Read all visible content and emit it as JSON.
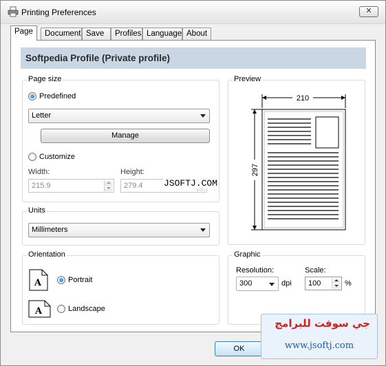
{
  "window": {
    "title": "Printing Preferences",
    "close_glyph": "✕"
  },
  "tabs": [
    {
      "label": "Page"
    },
    {
      "label": "Document"
    },
    {
      "label": "Save"
    },
    {
      "label": "Profiles"
    },
    {
      "label": "Language"
    },
    {
      "label": "About"
    }
  ],
  "profile": {
    "title": "Softpedia Profile (Private profile)"
  },
  "page_size": {
    "group_label": "Page size",
    "predefined_label": "Predefined",
    "predefined_selected": true,
    "paper_value": "Letter",
    "manage_label": "Manage",
    "customize_label": "Customize",
    "width_label": "Width:",
    "width_value": "215.9",
    "height_label": "Height:",
    "height_value": "279.4"
  },
  "units": {
    "group_label": "Units",
    "value": "Millimeters"
  },
  "orientation": {
    "group_label": "Orientation",
    "portrait_label": "Portrait",
    "landscape_label": "Landscape",
    "portrait_selected": true,
    "page_glyph": "A"
  },
  "preview": {
    "group_label": "Preview",
    "width_dim": "210",
    "height_dim": "297"
  },
  "graphic": {
    "group_label": "Graphic",
    "resolution_label": "Resolution:",
    "resolution_value": "300",
    "resolution_unit": "dpi",
    "scale_label": "Scale:",
    "scale_value": "100",
    "scale_unit": "%"
  },
  "buttons": {
    "ok_label": "OK"
  },
  "overlay": {
    "watermark_text": "JSOFTJ.COM"
  },
  "ad": {
    "arabic_text": "جي سوفت للبرامج",
    "url_text": "www.jsoftj.com"
  },
  "colors": {
    "accent": "#1b6ed3",
    "profile_bar": "#c9d6e3",
    "ad_red": "#d42020",
    "ad_green": "#1d8a2e"
  }
}
